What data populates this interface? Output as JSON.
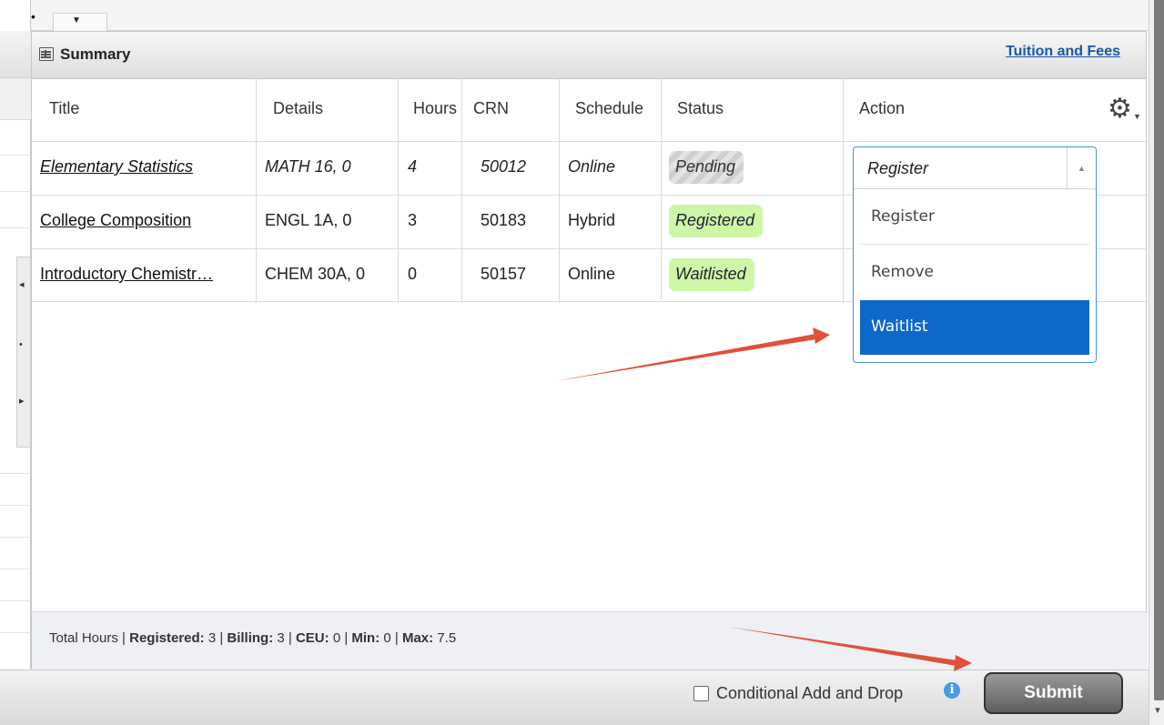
{
  "summary": {
    "title": "Summary",
    "tuition_link": "Tuition and Fees"
  },
  "table": {
    "columns": [
      "Title",
      "Details",
      "Hours",
      "CRN",
      "Schedule",
      "Status",
      "Action"
    ],
    "rows": [
      {
        "title": "Elementary Statistics",
        "details": "MATH 16, 0",
        "hours": "4",
        "crn": "50012",
        "schedule": "Online",
        "status": "Pending"
      },
      {
        "title": "College Composition",
        "details": "ENGL 1A, 0",
        "hours": "3",
        "crn": "50183",
        "schedule": "Hybrid",
        "status": "Registered"
      },
      {
        "title": "Introductory Chemistr…",
        "details": "CHEM 30A, 0",
        "hours": "0",
        "crn": "50157",
        "schedule": "Online",
        "status": "Waitlisted"
      }
    ]
  },
  "action_dropdown": {
    "current": "Register",
    "options": [
      "Register",
      "Remove",
      "Waitlist"
    ],
    "highlighted": "Waitlist"
  },
  "footer": {
    "prefix": "Total Hours |",
    "registered_label": "Registered:",
    "registered_value": "3",
    "billing_label": "Billing:",
    "billing_value": "3",
    "ceu_label": "CEU:",
    "ceu_value": "0",
    "min_label": "Min:",
    "min_value": "0",
    "max_label": "Max:",
    "max_value": "7.5"
  },
  "bottom_bar": {
    "conditional_label": "Conditional Add and Drop",
    "submit_label": "Submit"
  },
  "icons": {
    "panel": "table-icon",
    "gear": "gear-icon",
    "info": "info-icon"
  },
  "colors": {
    "link": "#1a57a8",
    "badge_green": "#cdf6a6",
    "dropdown_selected": "#0e68c8",
    "annotation_arrow": "#e0503a"
  }
}
